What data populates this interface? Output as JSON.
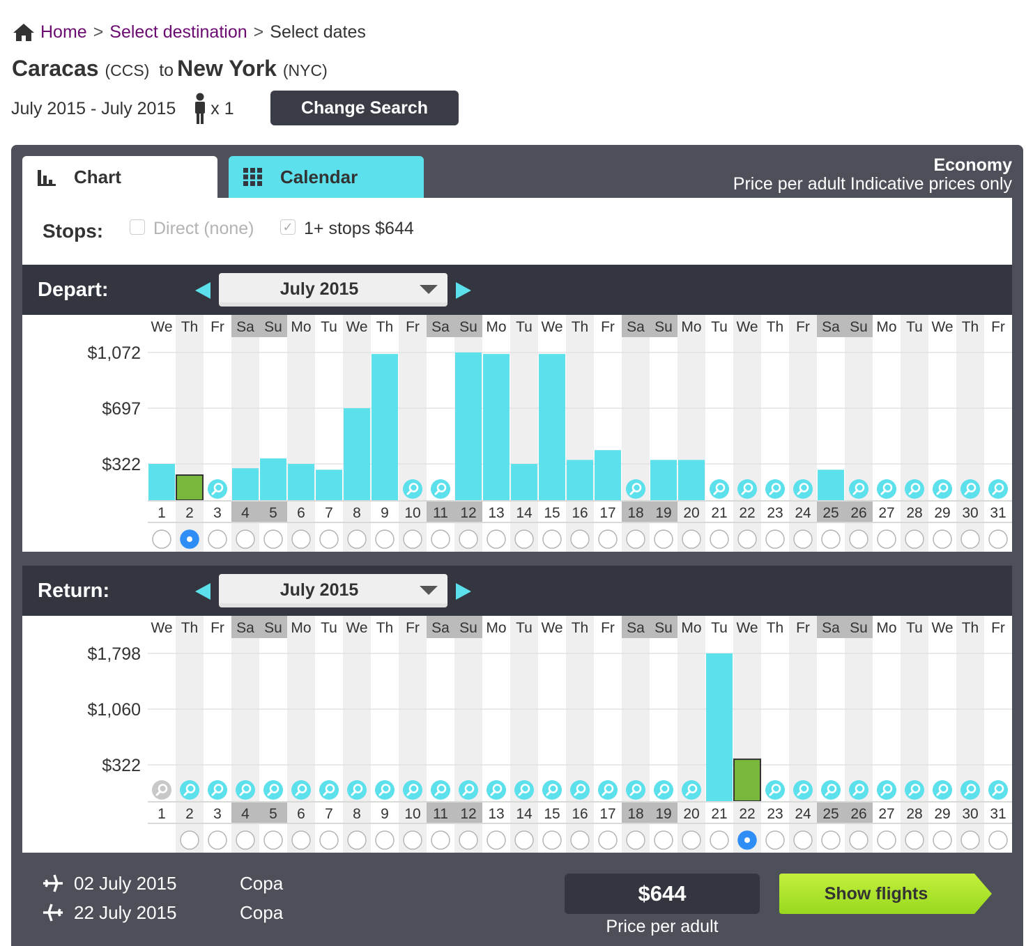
{
  "breadcrumb": {
    "home": "Home",
    "sep1": ">",
    "destination": "Select destination",
    "sep2": ">",
    "current": "Select dates"
  },
  "route": {
    "origin": "Caracas",
    "origin_code": "(CCS)",
    "to": "to",
    "destination": "New York",
    "destination_code": "(NYC)"
  },
  "search": {
    "date_range": "July 2015 - July 2015",
    "passengers": "x 1",
    "change_button": "Change Search"
  },
  "tabs": {
    "chart": "Chart",
    "calendar": "Calendar",
    "active": "chart"
  },
  "cabin": {
    "class": "Economy",
    "note": "Price per adult Indicative prices only"
  },
  "stops": {
    "label": "Stops:",
    "direct": "Direct (none)",
    "direct_checked": false,
    "one_plus": "1+ stops $644",
    "one_plus_checked": true
  },
  "colors": {
    "bar": "#5ce0ec",
    "selected_bar": "#79b63c",
    "weekend_header": "#bbbbbb",
    "weekday_alt": "#efefef",
    "radio_selected": "#2f8ef5",
    "show_flights": "#a6e22e"
  },
  "depart": {
    "label": "Depart:",
    "month": "July 2015",
    "axis_labels": [
      "$1,072",
      "$697",
      "$322"
    ],
    "axis_values": [
      1072,
      697,
      322
    ],
    "weekdays": [
      "We",
      "Th",
      "Fr",
      "Sa",
      "Su",
      "Mo",
      "Tu",
      "We",
      "Th",
      "Fr",
      "Sa",
      "Su",
      "Mo",
      "Tu",
      "We",
      "Th",
      "Fr",
      "Sa",
      "Su",
      "Mo",
      "Tu",
      "We",
      "Th",
      "Fr",
      "Sa",
      "Su",
      "Mo",
      "Tu",
      "We",
      "Th",
      "Fr"
    ],
    "days": [
      "1",
      "2",
      "3",
      "4",
      "5",
      "6",
      "7",
      "8",
      "9",
      "10",
      "11",
      "12",
      "13",
      "14",
      "15",
      "16",
      "17",
      "18",
      "19",
      "20",
      "21",
      "22",
      "23",
      "24",
      "25",
      "26",
      "27",
      "28",
      "29",
      "30",
      "31"
    ],
    "prices": [
      322,
      247,
      null,
      293,
      359,
      322,
      283,
      697,
      1062,
      null,
      null,
      1072,
      1062,
      322,
      1062,
      349,
      415,
      null,
      349,
      349,
      null,
      null,
      null,
      null,
      283,
      null,
      null,
      null,
      null,
      null,
      null
    ],
    "selected_day": 2
  },
  "return": {
    "label": "Return:",
    "month": "July 2015",
    "axis_labels": [
      "$1,798",
      "$1,060",
      "$322"
    ],
    "axis_values": [
      1798,
      1060,
      322
    ],
    "weekdays": [
      "We",
      "Th",
      "Fr",
      "Sa",
      "Su",
      "Mo",
      "Tu",
      "We",
      "Th",
      "Fr",
      "Sa",
      "Su",
      "Mo",
      "Tu",
      "We",
      "Th",
      "Fr",
      "Sa",
      "Su",
      "Mo",
      "Tu",
      "We",
      "Th",
      "Fr",
      "Sa",
      "Su",
      "Mo",
      "Tu",
      "We",
      "Th",
      "Fr"
    ],
    "days": [
      "1",
      "2",
      "3",
      "4",
      "5",
      "6",
      "7",
      "8",
      "9",
      "10",
      "11",
      "12",
      "13",
      "14",
      "15",
      "16",
      "17",
      "18",
      "19",
      "20",
      "21",
      "22",
      "23",
      "24",
      "25",
      "26",
      "27",
      "28",
      "29",
      "30",
      "31"
    ],
    "prices": [
      null,
      null,
      null,
      null,
      null,
      null,
      null,
      null,
      null,
      null,
      null,
      null,
      null,
      null,
      null,
      null,
      null,
      null,
      null,
      null,
      1798,
      397,
      null,
      null,
      null,
      null,
      null,
      null,
      null,
      null,
      null
    ],
    "disabled_days": [
      1
    ],
    "selected_day": 22
  },
  "summary": {
    "outbound_date": "02 July 2015",
    "outbound_airline": "Copa",
    "inbound_date": "22 July 2015",
    "inbound_airline": "Copa",
    "price": "$644",
    "price_caption": "Price per adult",
    "show_flights": "Show flights"
  }
}
